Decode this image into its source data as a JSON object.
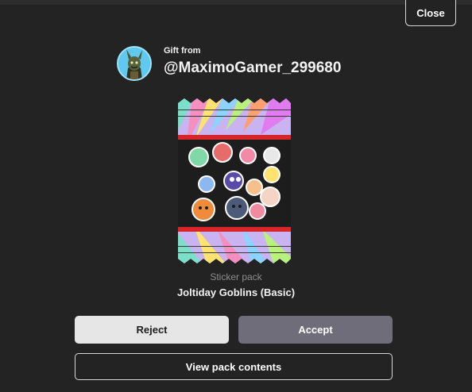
{
  "dialog": {
    "close_label": "Close",
    "gift_from_label": "Gift from",
    "sender_username": "@MaximoGamer_299680"
  },
  "pack": {
    "type_label": "Sticker pack",
    "name": "Joltiday Goblins (Basic)"
  },
  "actions": {
    "reject_label": "Reject",
    "accept_label": "Accept",
    "view_contents_label": "View pack contents"
  },
  "colors": {
    "background": "#232323",
    "accept_button": "#6f6d79",
    "reject_button": "#e6e6e6",
    "avatar_ring": "#5fc9ef"
  }
}
